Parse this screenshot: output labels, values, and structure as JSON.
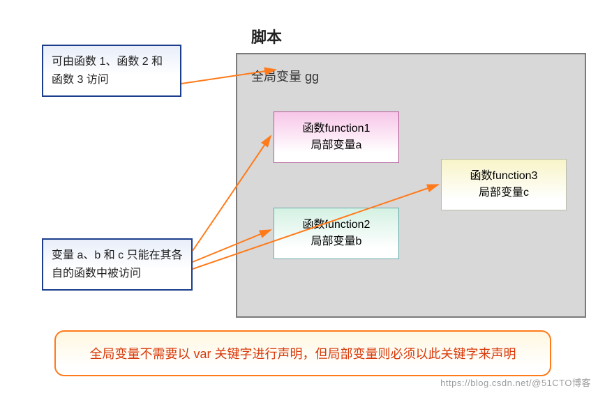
{
  "title": "脚本",
  "callout_top": "可由函数 1、函数 2 和函数 3 访问",
  "callout_bottom": "变量 a、b 和 c 只能在其各自的函数中被访问",
  "global_var": "全局变量 gg",
  "func1_line1": "函数function1",
  "func1_line2": "局部变量a",
  "func2_line1": "函数function2",
  "func2_line2": "局部变量b",
  "func3_line1": "函数function3",
  "func3_line2": "局部变量c",
  "banner": "全局变量不需要以 var 关键字进行声明，但局部变量则必须以此关键字来声明",
  "watermark": "https://blog.csdn.net/@51CTO博客"
}
